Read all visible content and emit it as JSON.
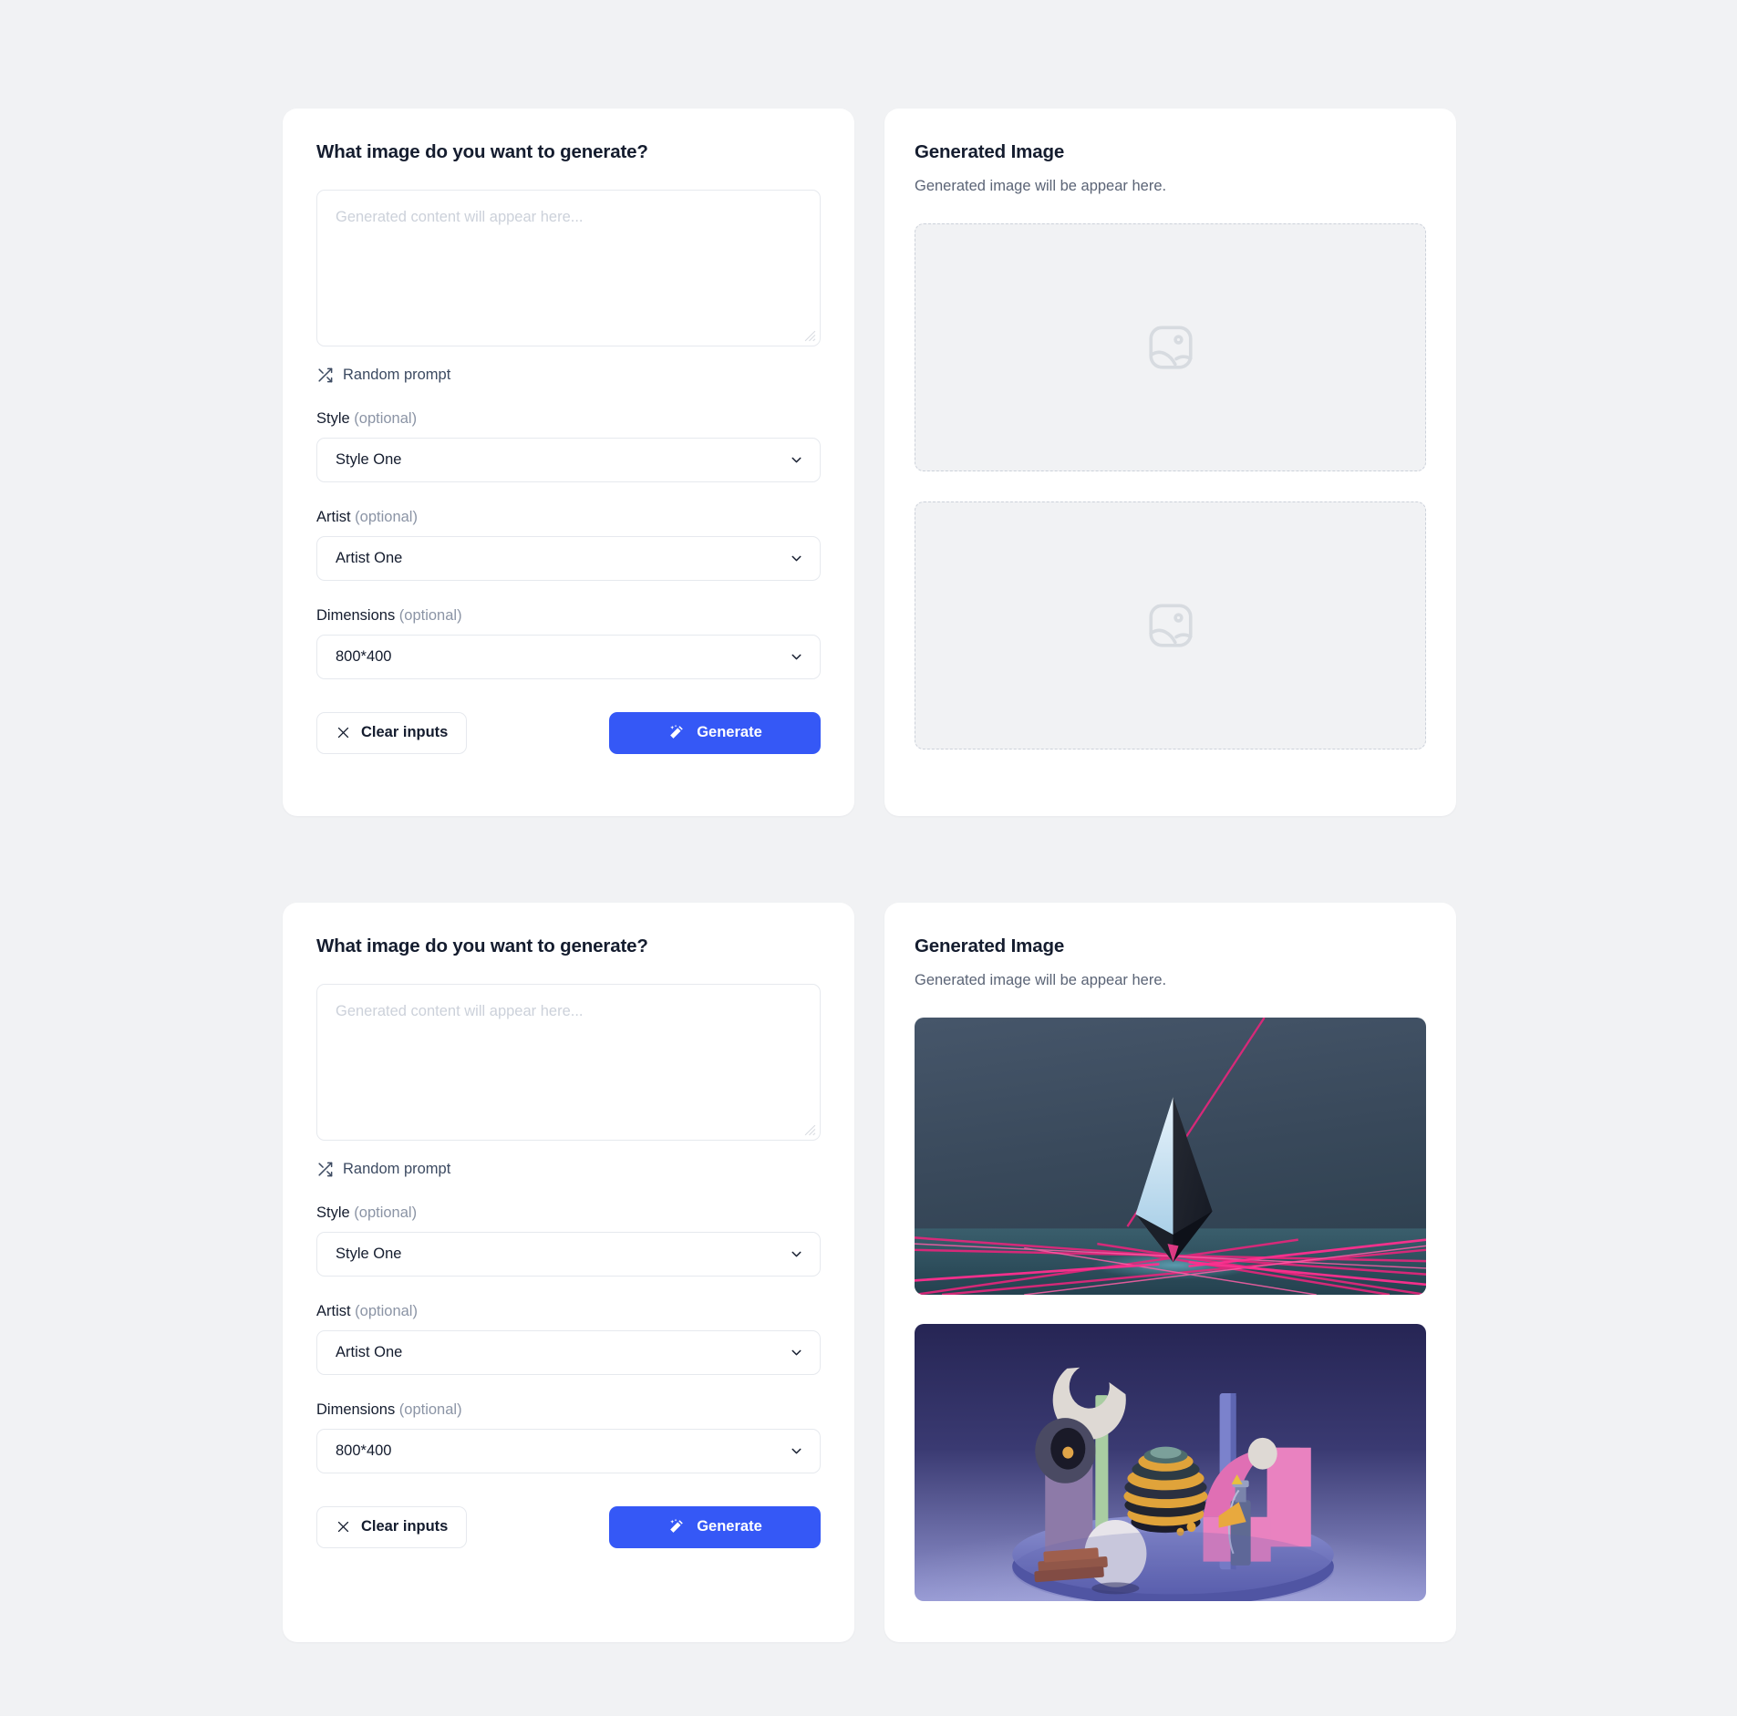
{
  "theme": {
    "page_bg": "#f1f2f4",
    "card_bg": "#ffffff",
    "accent": "#3558f6",
    "text_primary": "#141c2e",
    "text_muted": "#5b6476",
    "placeholder": "#ccd1da",
    "border": "#e6e9ee"
  },
  "form": {
    "title": "What image do you want to generate?",
    "prompt_placeholder": "Generated content will appear here...",
    "prompt_value": "",
    "random_prompt_label": "Random prompt",
    "fields": [
      {
        "label": "Style",
        "optional": " (optional)",
        "value": "Style One"
      },
      {
        "label": "Artist",
        "optional": " (optional)",
        "value": "Artist One"
      },
      {
        "label": "Dimensions",
        "optional": " (optional)",
        "value": "800*400"
      }
    ],
    "clear_label": "Clear inputs",
    "generate_label": "Generate"
  },
  "result": {
    "title": "Generated Image",
    "subtitle": "Generated image will be appear here.",
    "placeholder_icon": "image-placeholder-icon"
  },
  "images": {
    "first": {
      "alt": "dark teal 3d render with crystal prism and pink laser lines",
      "bg_top": "#3e4e60",
      "bg_bottom": "#2b3a49",
      "floor": "#32505e",
      "accent": "#f0257f"
    },
    "second": {
      "alt": "purple 3d still life with abstract objects on a circular platform",
      "bg_top": "#2a2a55",
      "bg_bottom": "#8e92cd",
      "platform": "#6e74bb",
      "pink": "#e583c0"
    }
  },
  "icons": {
    "shuffle": "shuffle-icon",
    "chevron": "chevron-down-icon",
    "close": "close-icon",
    "wand": "magic-wand-icon"
  }
}
